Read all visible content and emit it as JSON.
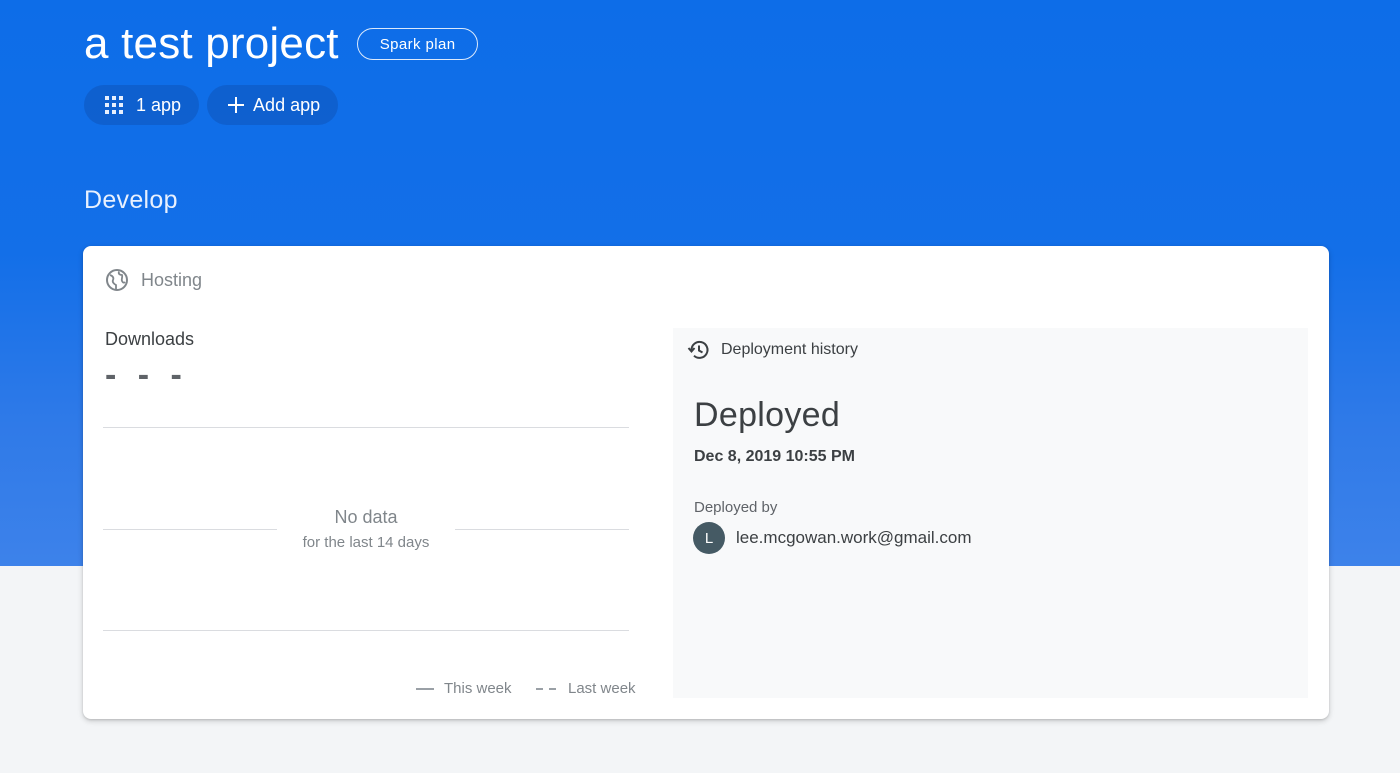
{
  "project": {
    "title": "a test project",
    "plan_label": "Spark plan"
  },
  "chips": {
    "apps_label": "1 app",
    "add_app_label": "Add app"
  },
  "section": {
    "title": "Develop"
  },
  "hosting_card": {
    "title": "Hosting",
    "icon": "globe-icon",
    "downloads": {
      "label": "Downloads",
      "value": "- - -"
    },
    "chart": {
      "empty_title": "No data",
      "empty_subtitle": "for the last 14 days",
      "legend": [
        "This week",
        "Last week"
      ]
    },
    "deployment": {
      "header": "Deployment history",
      "icon": "history-icon",
      "status": "Deployed",
      "date": "Dec 8, 2019 10:55 PM",
      "deployed_by_label": "Deployed by",
      "avatar_initial": "L",
      "user_email": "lee.mcgowan.work@gmail.com"
    }
  },
  "colors": {
    "hero_blue": "#0d6de8",
    "avatar_bg": "#455a64",
    "page_bg": "#f3f5f7"
  }
}
